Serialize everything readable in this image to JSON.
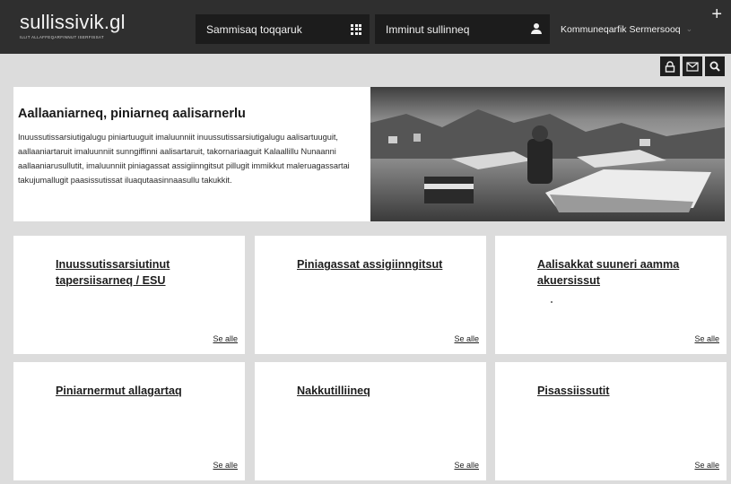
{
  "header": {
    "logo_name": "sullissivik.gl",
    "logo_tagline": "ILLIT ALLAFFEQARFINNUT ISERFISSAT",
    "services_label": "Sammisaq toqqaruk",
    "login_label": "Imminut sullinneq",
    "municipality_label": "Kommuneqarfik Sermersooq",
    "colors": {
      "header_bg": "#2f2f2f",
      "field_bg": "#1c1c1c",
      "page_bg": "#dcdcdc"
    }
  },
  "utilities": {
    "icons": [
      "lock-icon",
      "mail-icon",
      "search-icon"
    ]
  },
  "hero": {
    "title": "Aallaaniarneq, piniarneq aalisarnerlu",
    "body": "Inuussutissarsiutigalugu piniartuuguit imaluunniit inuussutissarsiutigalugu aalisartuuguit, aallaaniartaruit imaluunniit sunngiffinni aalisartaruit, takornariaaguit Kalaallillu Nunaanni aallaaniarusullutit, imaluunniit piniagassat assigiinngitsut pillugit immikkut maleruagassartai takujumallugit paasissutissat iluaqutaasinnaasullu takukkit."
  },
  "cards": [
    {
      "title": "Inuussutissarsiutinut tapersiisarneq / ESU",
      "link": "Se alle"
    },
    {
      "title": "Piniagassat assigiinngitsut",
      "link": "Se alle"
    },
    {
      "title": "Aalisakkat suuneri aamma akuersissut",
      "link": "Se alle"
    },
    {
      "title": "Piniarnermut allagartaq",
      "link": "Se alle"
    },
    {
      "title": "Nakkutilliineq",
      "link": "Se alle"
    },
    {
      "title": "Pisassiissutit",
      "link": "Se alle"
    }
  ]
}
